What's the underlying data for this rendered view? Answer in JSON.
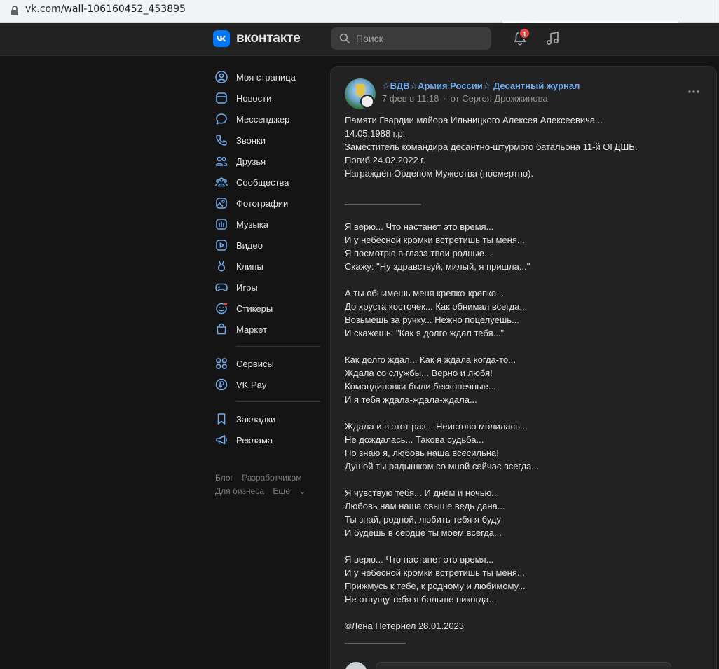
{
  "browser": {
    "url": "vk.com/wall-106160452_453895"
  },
  "header": {
    "logo_text": "вконтакте",
    "search_placeholder": "Поиск",
    "notification_count": "1"
  },
  "nav": {
    "items": [
      {
        "label": "Моя страница",
        "icon": "profile-icon"
      },
      {
        "label": "Новости",
        "icon": "news-icon"
      },
      {
        "label": "Мессенджер",
        "icon": "messenger-icon"
      },
      {
        "label": "Звонки",
        "icon": "phone-icon"
      },
      {
        "label": "Друзья",
        "icon": "friends-icon"
      },
      {
        "label": "Сообщества",
        "icon": "communities-icon"
      },
      {
        "label": "Фотографии",
        "icon": "photos-icon"
      },
      {
        "label": "Музыка",
        "icon": "music-icon"
      },
      {
        "label": "Видео",
        "icon": "video-icon"
      },
      {
        "label": "Клипы",
        "icon": "clips-icon"
      },
      {
        "label": "Игры",
        "icon": "games-icon"
      },
      {
        "label": "Стикеры",
        "icon": "stickers-icon"
      },
      {
        "label": "Маркет",
        "icon": "market-icon"
      }
    ],
    "items2": [
      {
        "label": "Сервисы",
        "icon": "services-icon"
      },
      {
        "label": "VK Pay",
        "icon": "vkpay-icon"
      }
    ],
    "items3": [
      {
        "label": "Закладки",
        "icon": "bookmarks-icon"
      },
      {
        "label": "Реклама",
        "icon": "ads-icon"
      }
    ],
    "footer": {
      "blog": "Блог",
      "developers": "Разработчикам",
      "business": "Для бизнеса",
      "more": "Ещё"
    }
  },
  "post": {
    "author": "☆ВДВ☆Армия России☆ Десантный журнал",
    "date": "7 фев в 11:18",
    "from": "от Сергея Дрожжинова",
    "lines": [
      "Памяти Гвардии майора Ильницкого Алексея Алексеевича...",
      "14.05.1988 г.р.",
      "Заместитель командира десантно-штурмого батальона 11-й ОГДШБ.",
      "Погиб 24.02.2022 г.",
      "Награждён Орденом Мужества (посмертно).",
      "",
      "_______________",
      "",
      "Я верю... Что настанет это время...",
      "И у небесной кромки встретишь ты меня...",
      "Я посмотрю в глаза твои родные...",
      "Скажу: \"Ну здравствуй, милый, я пришла...\"",
      "",
      "А ты обнимешь меня крепко-крепко...",
      "До хруста косточек... Как обнимал всегда...",
      "Возьмёшь за ручку... Нежно поцелуешь...",
      "И скажешь: \"Как я долго ждал тебя...\"",
      "",
      "Как долго ждал... Как я ждала когда-то...",
      "Ждала со службы... Верно и любя!",
      "Командировки были бесконечные...",
      "И я тебя ждала-ждала-ждала...",
      "",
      "Ждала и в этот раз... Неистово молилась...",
      "Не дождалась... Такова судьба...",
      "Но знаю я, любовь наша всесильна!",
      "Душой ты рядышком со мной сейчас всегда...",
      "",
      "Я чувствую тебя... И днём и ночью...",
      "Любовь нам наша свыше ведь дана...",
      "Ты знай, родной, любить тебя я буду",
      "И будешь в сердце ты моём всегда...",
      "",
      "Я верю... Что настанет это время...",
      "И у небесной кромки встретишь ты меня...",
      "Прижмусь к тебе, к родному и любимому...",
      "Не отпущу тебя я больше никогда...",
      "",
      "©Лена Петернел 28.01.2023",
      "____________"
    ]
  },
  "colors": {
    "accent": "#0077ff",
    "link": "#71aaeb",
    "badge": "#e64646"
  }
}
